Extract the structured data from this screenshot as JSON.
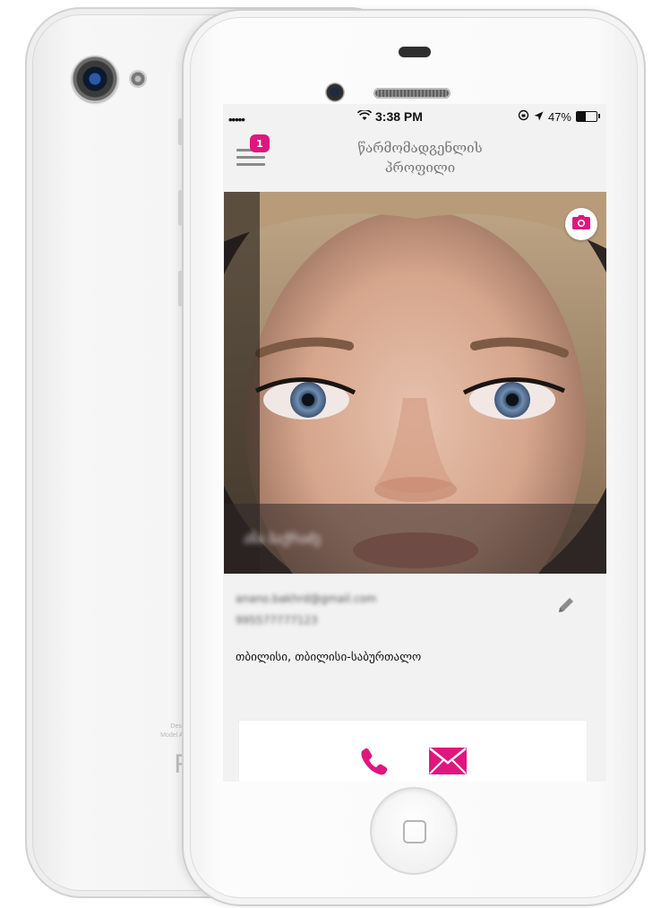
{
  "back_phone": {
    "model_text": "Designed\nModel A1387",
    "logo": "R"
  },
  "status_bar": {
    "signal": "•••••",
    "time": "3:38 PM",
    "battery": "47%",
    "battery_level": 0.47
  },
  "nav": {
    "title_line1": "წარმომადგენლის",
    "title_line2": "პროფილი",
    "badge": "1"
  },
  "profile": {
    "caption_blurred": "ანა ბაქრაძე",
    "email_blurred": "anano.bakhrd@gmail.com",
    "phone_blurred": "995577777123",
    "address": "თბილისი, თბილისი-საბურთალო"
  },
  "icons": {
    "menu": "menu-icon",
    "camera": "camera-icon",
    "edit": "pencil-icon",
    "phone": "phone-icon",
    "mail": "mail-icon",
    "accent": "#e0167f"
  }
}
